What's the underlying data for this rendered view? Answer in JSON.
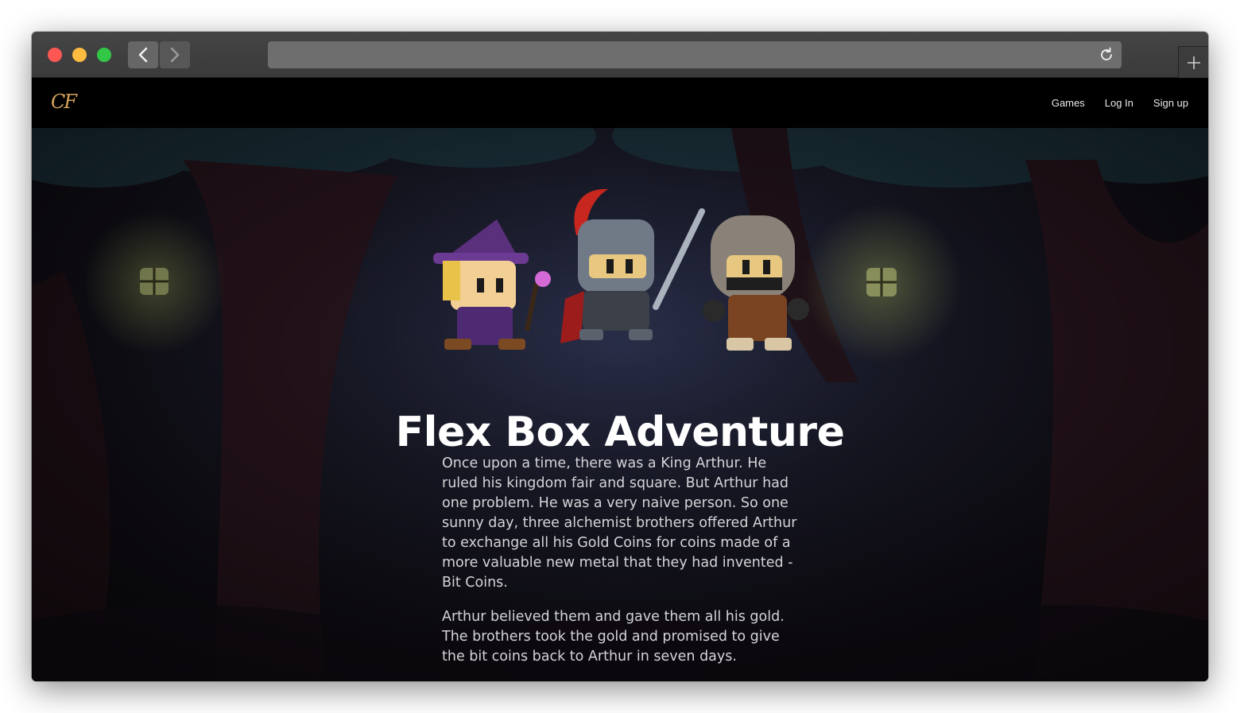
{
  "browser": {
    "back_icon": "chevron-left-icon",
    "forward_icon": "chevron-right-icon",
    "reload_icon": "reload-icon",
    "new_tab_icon": "plus-icon",
    "url": ""
  },
  "site": {
    "logo": "CF",
    "nav": {
      "games": "Games",
      "login": "Log In",
      "signup": "Sign up"
    }
  },
  "hero": {
    "title": "Flex Box Adventure",
    "paragraphs": [
      "Once upon a time, there was a King Arthur. He ruled his kingdom fair and square. But Arthur had one problem. He was a very naive person. So one sunny day, three alchemist brothers offered Arthur to exchange all his Gold Coins for coins made of a more valuable new metal that they had invented - Bit Coins.",
      "Arthur believed them and gave them all his gold. The brothers took the gold and promised to give the bit coins back to Arthur in seven days."
    ]
  },
  "colors": {
    "logo": "#d4a35a",
    "close": "#fc5753",
    "minimize": "#fdbc40",
    "zoom": "#33c748"
  }
}
